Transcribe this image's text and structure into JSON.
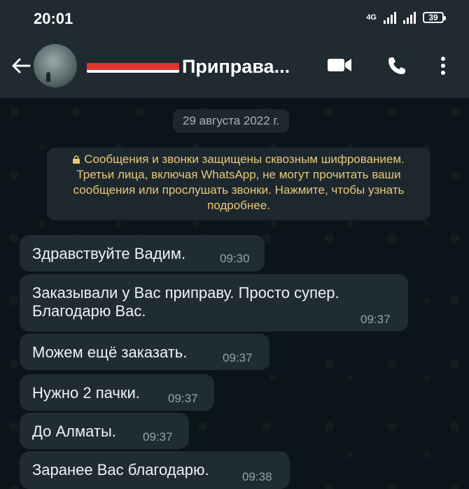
{
  "status_bar": {
    "time": "20:01",
    "network": "4G",
    "battery": "39"
  },
  "header": {
    "contact_name": "Приправа...",
    "icons": [
      "back-arrow-icon",
      "video-call-icon",
      "phone-icon",
      "more-vert-icon"
    ]
  },
  "chat": {
    "date": "29 августа 2022 г.",
    "encryption_notice": "Сообщения и звонки защищены сквозным шифрованием. Третьи лица, включая WhatsApp, не могут прочитать ваши сообщения или прослушать звонки. Нажмите, чтобы узнать подробнее.",
    "messages": [
      {
        "text": "Здравствуйте Вадим.",
        "time": "09:30"
      },
      {
        "text": "Заказывали у Вас приправу. Просто супер. Благодарю Вас.",
        "time": "09:37"
      },
      {
        "text": "Можем ещё заказать.",
        "time": "09:37"
      },
      {
        "text": "Нужно 2 пачки.",
        "time": "09:37"
      },
      {
        "text": "До Алматы.",
        "time": "09:37"
      },
      {
        "text": "Заранее Вас благодарю.",
        "time": "09:38"
      }
    ]
  },
  "colors": {
    "header_bg": "#1f2b31",
    "chat_bg": "#0b1418",
    "bubble_bg": "#1f2c33",
    "notice_text": "#e9c877",
    "time_text": "#95a3ab"
  }
}
